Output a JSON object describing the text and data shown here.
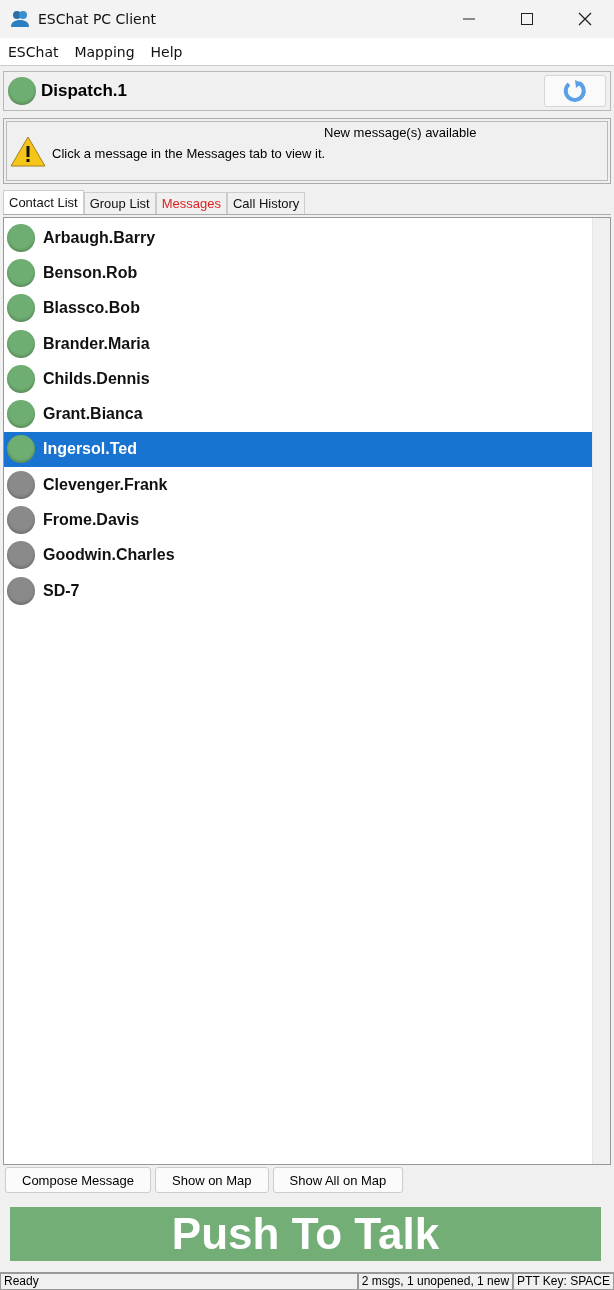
{
  "window": {
    "title": "ESChat PC Client"
  },
  "menu": [
    "ESChat",
    "Mapping",
    "Help"
  ],
  "user": {
    "name": "Dispatch.1",
    "color": "#6fae72"
  },
  "alert": {
    "title": "New message(s) available",
    "text": "Click a message in the Messages tab to view it."
  },
  "tabs": [
    {
      "label": "Contact List",
      "selected": true,
      "highlighted": false
    },
    {
      "label": "Group List",
      "selected": false,
      "highlighted": false
    },
    {
      "label": "Messages",
      "selected": false,
      "highlighted": true
    },
    {
      "label": "Call History",
      "selected": false,
      "highlighted": false
    }
  ],
  "contacts": [
    {
      "name": "Arbaugh.Barry",
      "color": "#6fae72",
      "selected": false
    },
    {
      "name": "Benson.Rob",
      "color": "#6fae72",
      "selected": false
    },
    {
      "name": "Blassco.Bob",
      "color": "#6fae72",
      "selected": false
    },
    {
      "name": "Brander.Maria",
      "color": "#6fae72",
      "selected": false
    },
    {
      "name": "Childs.Dennis",
      "color": "#6fae72",
      "selected": false
    },
    {
      "name": "Grant.Bianca",
      "color": "#6fae72",
      "selected": false
    },
    {
      "name": "Ingersol.Ted",
      "color": "#6fae72",
      "selected": true
    },
    {
      "name": "Clevenger.Frank",
      "color": "#8a8a8a",
      "selected": false
    },
    {
      "name": "Frome.Davis",
      "color": "#8a8a8a",
      "selected": false
    },
    {
      "name": "Goodwin.Charles",
      "color": "#8a8a8a",
      "selected": false
    },
    {
      "name": "SD-7",
      "color": "#8a8a8a",
      "selected": false
    }
  ],
  "buttons": [
    "Compose Message",
    "Show on Map",
    "Show All on Map"
  ],
  "ptt": {
    "label": "Push To Talk"
  },
  "status_bar": [
    "Ready",
    "2 msgs, 1 unopened, 1 new",
    "PTT Key: SPACE"
  ]
}
